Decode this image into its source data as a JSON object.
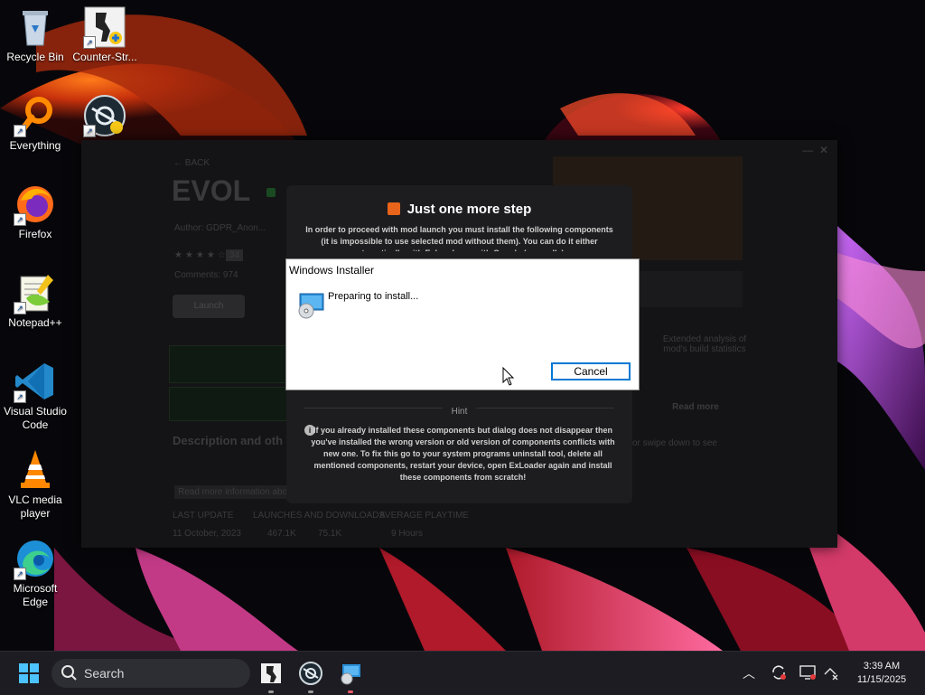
{
  "desktop": {
    "icons": [
      {
        "label": "Recycle Bin"
      },
      {
        "label": "Counter-Str..."
      },
      {
        "label": "Everything"
      },
      {
        "label": ""
      },
      {
        "label": "Firefox"
      },
      {
        "label": "Notepad++"
      },
      {
        "label": "Visual Studio Code"
      },
      {
        "label": "VLC media player"
      },
      {
        "label": "Microsoft Edge"
      }
    ]
  },
  "app": {
    "back": "← BACK",
    "title": "EVOL",
    "author": "Author: GDPR_Anon...",
    "rating": "34",
    "comments": "Comments: 974",
    "launch": "Launch",
    "description_heading": "Description and oth",
    "read_more": "Read more information about",
    "stats": [
      "LAST UPDATE",
      "LAUNCHES AND DOWNLOADS",
      "AVERAGE PLAYTIME"
    ],
    "stat_values": [
      "11 October, 2023",
      "467.1K",
      "75.1K",
      "9 Hours"
    ],
    "side_text": "Extended analysis of mod's build statistics",
    "read_more_right": "Read more",
    "swipe": "or swipe down to see"
  },
  "modal": {
    "title": "Just one more step",
    "body": "In order to proceed with mod launch you must install the following components (it is impossible to use selected mod without them). You can do it either automatically with ExLoader or with Google (manually).",
    "hint_label": "Hint",
    "hint_text": "If you already installed these components but dialog does not disappear then you've installed the wrong version or old version of components conflicts with new one. To fix this go to your system programs uninstall tool, delete all mentioned components, restart your device, open ExLoader again and install these components from scratch!"
  },
  "installer": {
    "title": "Windows Installer",
    "message": "Preparing to install...",
    "cancel": "Cancel"
  },
  "taskbar": {
    "search_label": "Search",
    "time": "3:39 AM",
    "date": "11/15/2025"
  },
  "colors": {
    "accent_blue": "#0078d4",
    "modal_orange": "#e8641a",
    "taskbar_bg": "#1c1c22"
  }
}
